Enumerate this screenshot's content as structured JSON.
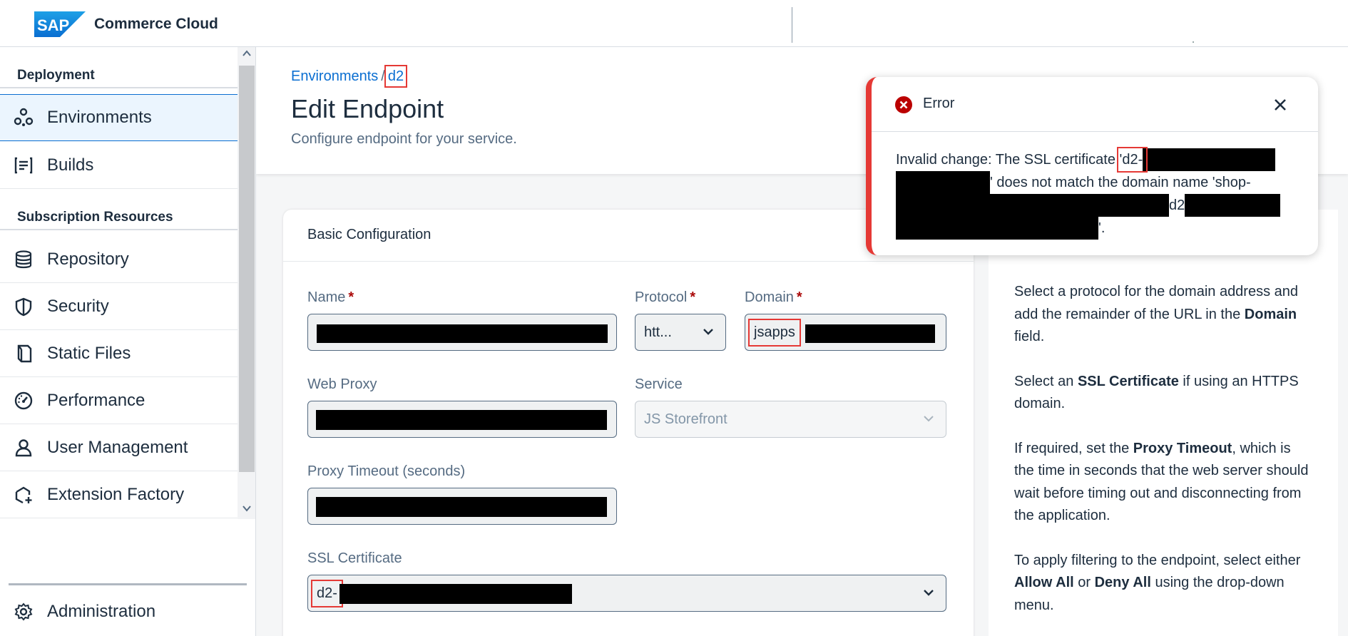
{
  "header": {
    "brand": "SAP",
    "app_title": "Commerce Cloud"
  },
  "sidebar": {
    "section1": "Deployment",
    "section2": "Subscription Resources",
    "items": [
      {
        "label": "Environments",
        "icon": "environments-icon"
      },
      {
        "label": "Builds",
        "icon": "builds-icon"
      },
      {
        "label": "Repository",
        "icon": "database-icon"
      },
      {
        "label": "Security",
        "icon": "shield-icon"
      },
      {
        "label": "Static Files",
        "icon": "file-icon"
      },
      {
        "label": "Performance",
        "icon": "gauge-icon"
      },
      {
        "label": "User Management",
        "icon": "user-icon"
      },
      {
        "label": "Extension Factory",
        "icon": "extension-icon"
      }
    ],
    "admin": "Administration"
  },
  "breadcrumb": {
    "root": "Environments",
    "sep": "/",
    "current": "d2"
  },
  "page": {
    "title": "Edit Endpoint",
    "subtitle": "Configure endpoint for your service."
  },
  "card": {
    "title": "Basic Configuration",
    "name_label": "Name",
    "protocol_label": "Protocol",
    "protocol_value": "htt...",
    "domain_label": "Domain",
    "domain_value": "jsapps",
    "webproxy_label": "Web Proxy",
    "service_label": "Service",
    "service_value": "JS Storefront",
    "timeout_label": "Proxy Timeout (seconds)",
    "ssl_label": "SSL Certificate",
    "ssl_value": "d2-",
    "required_mark": "*"
  },
  "help": {
    "p1a": "Select a protocol for the domain address and add the remainder of the URL in the ",
    "p1b": "Domain",
    "p1c": " field.",
    "p2a": "Select an ",
    "p2b": "SSL Certificate",
    "p2c": " if using an HTTPS domain.",
    "p3a": "If required, set the ",
    "p3b": "Proxy Timeout",
    "p3c": ", which is the time in seconds that the web server should wait before timing out and disconnecting from the application.",
    "p4a": "To apply filtering to the endpoint, select either ",
    "p4b": "Allow All",
    "p4c": " or ",
    "p4d": "Deny All",
    "p4e": " using the drop-down menu."
  },
  "error": {
    "title": "Error",
    "msg1": "Invalid change: The SSL certificate '",
    "msg_cert": "d2-",
    "msg2": "' does not match the domain name 'shop-",
    "msg_d2": "d2",
    "msg3": "'."
  },
  "colors": {
    "accent": "#0a6ed1",
    "error": "#e53935",
    "required": "#aa0808"
  }
}
